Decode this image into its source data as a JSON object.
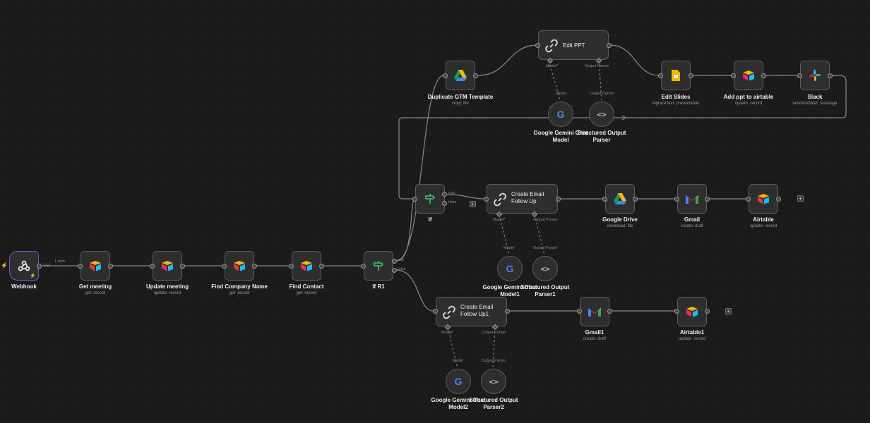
{
  "nodes": {
    "webhook": {
      "label": "Webhook",
      "icon": "webhook-icon"
    },
    "get_meeting": {
      "label": "Get meeting",
      "sub": "get: record",
      "icon": "airtable-icon"
    },
    "update_meeting": {
      "label": "Update meeting",
      "sub": "update: record",
      "icon": "airtable-icon"
    },
    "find_company": {
      "label": "Find Company Name",
      "sub": "get: record",
      "icon": "airtable-icon"
    },
    "find_contact": {
      "label": "Find Contact",
      "sub": "get: record",
      "icon": "airtable-icon"
    },
    "if_r1": {
      "label": "If R1",
      "icon": "signpost-icon"
    },
    "if": {
      "label": "If",
      "icon": "signpost-icon"
    },
    "duplicate_gtm": {
      "label": "Duplicate GTM Template",
      "sub": "copy: file",
      "icon": "google-drive-icon"
    },
    "edit_ppt": {
      "label": "Edit PPT",
      "icon": "link-icon"
    },
    "edit_slides": {
      "label": "Edit Slides",
      "sub": "replaceText: presentation",
      "icon": "google-slides-icon"
    },
    "add_ppt": {
      "label": "Add ppt to airtable",
      "sub": "update: record",
      "icon": "airtable-icon"
    },
    "slack": {
      "label": "Slack",
      "sub": "sendAndWait: message",
      "icon": "slack-icon"
    },
    "gemini_0": {
      "label": "Google Gemini Chat Model",
      "icon": "google-g-icon"
    },
    "parser_0": {
      "label": "Structured Output Parser",
      "icon": "code-brackets-icon"
    },
    "create_email": {
      "label": "Create Email Follow Up",
      "icon": "link-icon"
    },
    "google_drive": {
      "label": "Google Drive",
      "sub": "download: file",
      "icon": "google-drive-icon"
    },
    "gmail": {
      "label": "Gmail",
      "sub": "create: draft",
      "icon": "gmail-icon"
    },
    "airtable": {
      "label": "Airtable",
      "sub": "update: record",
      "icon": "airtable-icon"
    },
    "gemini_1": {
      "label": "Google Gemini Chat Model1",
      "icon": "google-g-icon"
    },
    "parser_1": {
      "label": "Structured Output Parser1",
      "icon": "code-brackets-icon"
    },
    "create_email1": {
      "label": "Create Email Follow Up1",
      "icon": "link-icon"
    },
    "gmail1": {
      "label": "Gmail1",
      "sub": "create: draft",
      "icon": "gmail-icon"
    },
    "airtable1": {
      "label": "Airtable1",
      "sub": "update: record",
      "icon": "airtable-icon"
    },
    "gemini_2": {
      "label": "Google Gemini Chat Model2",
      "icon": "google-g-icon"
    },
    "parser_2": {
      "label": "Structured Output Parser2",
      "icon": "code-brackets-icon"
    }
  },
  "edge_labels": {
    "webhook_out": "1 item",
    "webhook_branch": "GET",
    "true": "true",
    "false": "false",
    "model_star": "Model*",
    "output_parser": "Output Parser",
    "model": "Model"
  },
  "colors": {
    "canvas": "#1b1b1b",
    "node": "#2e2e2e",
    "border": "#5c5c5c",
    "webhook_accent": "#6b5cd6",
    "edge": "#8a8a8a"
  }
}
